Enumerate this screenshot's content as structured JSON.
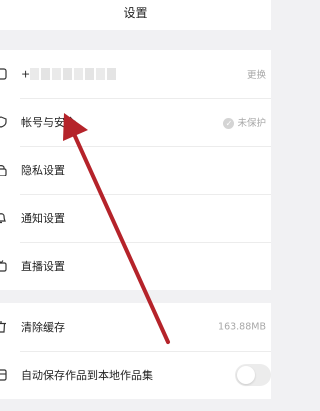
{
  "header": {
    "title": "设置"
  },
  "groups": [
    {
      "rows": [
        {
          "type": "phone",
          "prefix": "+",
          "value": "更换",
          "icon": "phone-icon"
        },
        {
          "label": "帐号与安全",
          "value": "未保护",
          "icon": "shield-icon",
          "status_icon": "check-circle-icon"
        },
        {
          "label": "隐私设置",
          "icon": "lock-icon"
        },
        {
          "label": "通知设置",
          "icon": "bell-icon"
        },
        {
          "label": "直播设置",
          "icon": "live-icon"
        }
      ]
    },
    {
      "rows": [
        {
          "label": "清除缓存",
          "value": "163.88MB",
          "icon": "trash-icon"
        },
        {
          "label": "自动保存作品到本地作品集",
          "icon": "save-icon",
          "toggle": false
        }
      ]
    }
  ],
  "colors": {
    "background": "#f1f1f3",
    "arrow": "#b5232a"
  }
}
